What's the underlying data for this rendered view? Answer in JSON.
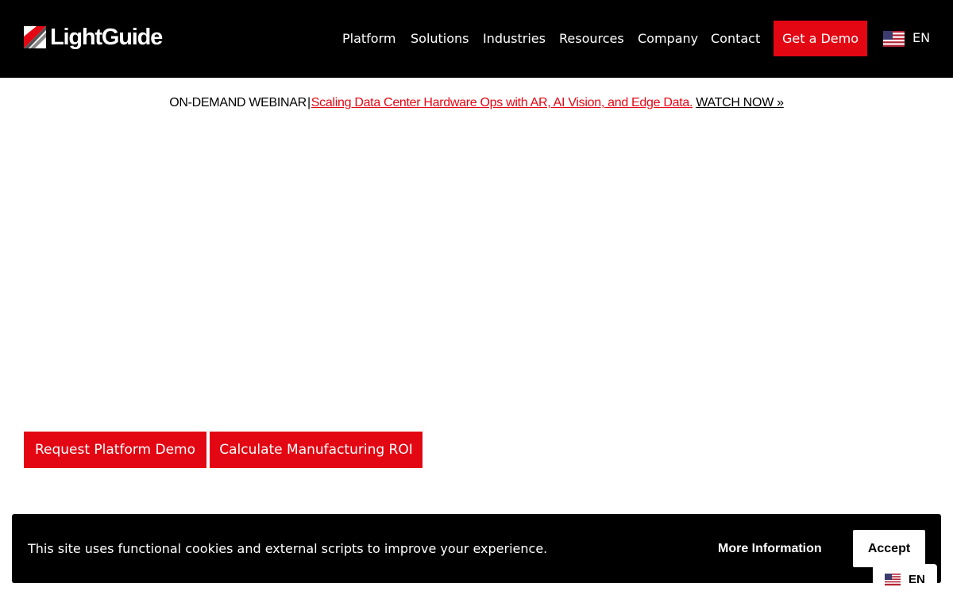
{
  "header": {
    "logo_text": "LightGuide",
    "nav": [
      "Platform",
      "Solutions",
      "Industries",
      "Resources",
      "Company",
      "Contact"
    ],
    "demo_label": "Get a Demo",
    "language": "EN",
    "flag_icon": "us-flag-icon"
  },
  "banner": {
    "label": "ON-DEMAND WEBINAR",
    "separator": "|",
    "link_text": "Scaling Data Center Hardware Ops with AR, AI Vision, and Edge Data.",
    "cta_text": "WATCH NOW »"
  },
  "hero": {
    "buttons": [
      "Request Platform Demo",
      "Calculate Manufacturing ROI"
    ]
  },
  "cookie": {
    "message": "This site uses functional cookies and external scripts to improve your experience.",
    "more_info": "More Information",
    "accept": "Accept"
  },
  "language_widget": {
    "label": "EN"
  },
  "colors": {
    "brand_red": "#e30613",
    "header_bg": "#000000"
  }
}
